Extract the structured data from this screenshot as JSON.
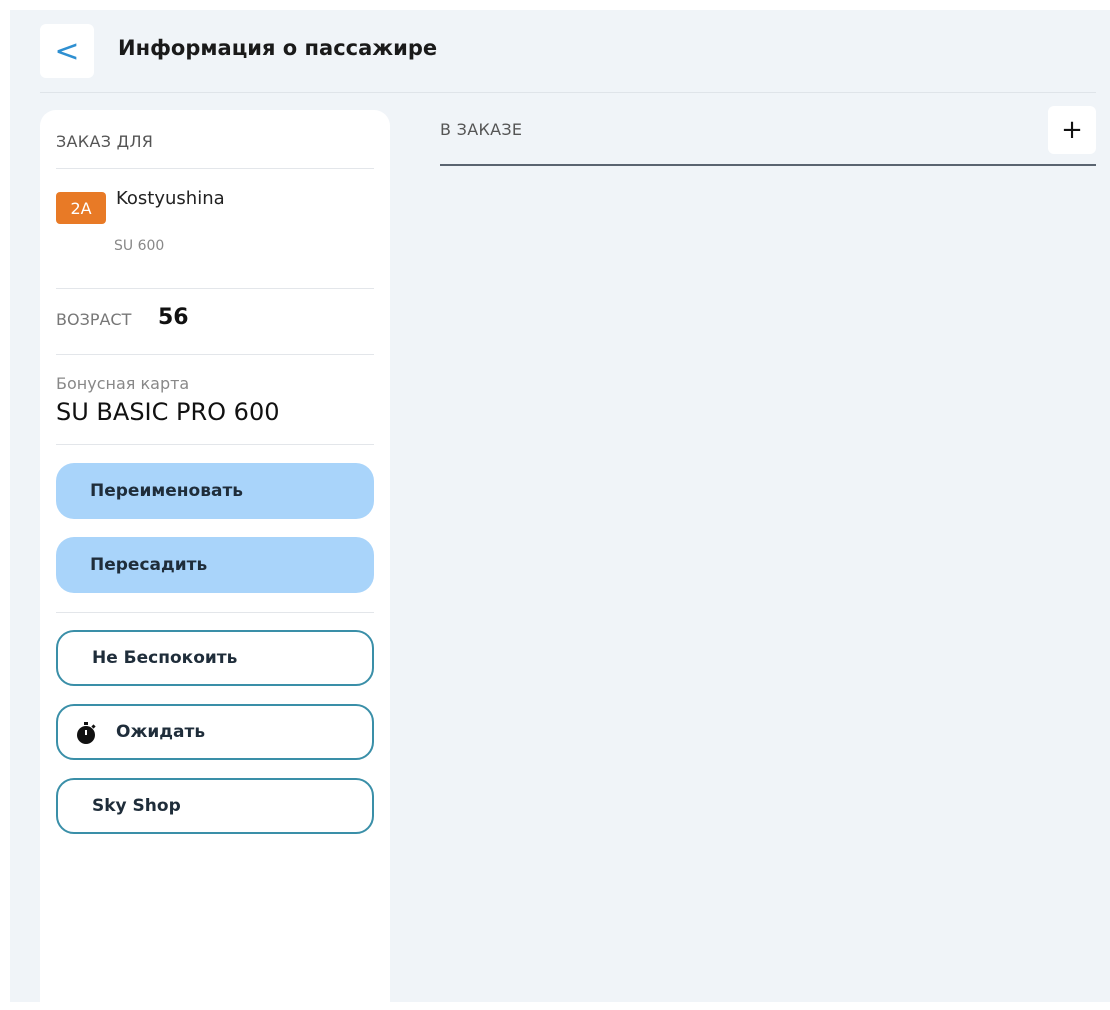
{
  "header": {
    "back_label": "<",
    "title": "Информация о пассажире"
  },
  "passenger_panel": {
    "heading": "ЗАКАЗ ДЛЯ",
    "seat": "2A",
    "name": "Kostyushina",
    "flight": "SU 600",
    "age_label": "ВОЗРАСТ",
    "age_value": "56",
    "bonus_label": "Бонусная карта",
    "bonus_value": "SU BASIC PRO 600",
    "buttons": {
      "rename": "Переименовать",
      "reseat": "Пересадить",
      "dnd": "Не Беспокоить",
      "wait": "Ожидать",
      "sky_shop": "Sky Shop"
    }
  },
  "order_panel": {
    "heading": "В ЗАКАЗЕ",
    "add_label": "+"
  },
  "colors": {
    "accent": "#2e8fd1",
    "seat_badge": "#e87a26",
    "filled_button": "#a9d4fa",
    "outline_button_border": "#3a8fa8",
    "background": "#f0f4f8"
  }
}
